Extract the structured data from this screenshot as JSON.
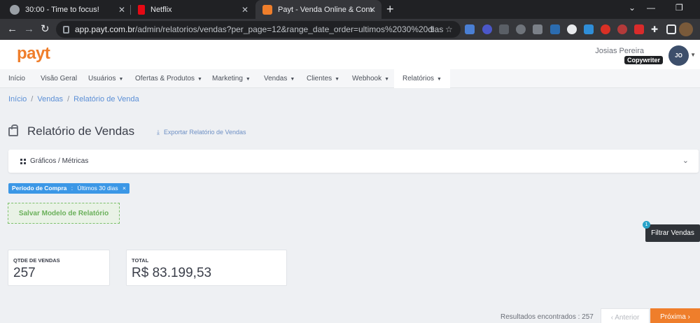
{
  "browser": {
    "tabs": [
      {
        "title": "30:00 - Time to focus!",
        "favicon_color": "#9aa0a6"
      },
      {
        "title": "Netflix",
        "favicon_color": "#e50914"
      },
      {
        "title": "Payt - Venda Online & Conversão",
        "favicon_color": "#ef7e2b"
      }
    ],
    "new_tab": "+",
    "url_host": "app.payt.com.br",
    "url_path": "/admin/relatorios/vendas?per_page=12&range_date_order=ultimos%2030%20dias"
  },
  "header": {
    "logo": "payt",
    "user_name": "Josias Pereira",
    "user_role": "Copywriter",
    "user_initials": "JO"
  },
  "nav": {
    "items": [
      {
        "label": "Início",
        "dropdown": false
      },
      {
        "label": "Visão Geral",
        "dropdown": false
      },
      {
        "label": "Usuários",
        "dropdown": true
      },
      {
        "label": "Ofertas & Produtos",
        "dropdown": true
      },
      {
        "label": "Marketing",
        "dropdown": true
      },
      {
        "label": "Vendas",
        "dropdown": true
      },
      {
        "label": "Clientes",
        "dropdown": true
      },
      {
        "label": "Webhook",
        "dropdown": true
      },
      {
        "label": "Relatórios",
        "dropdown": true
      }
    ]
  },
  "breadcrumb": [
    "Início",
    "Vendas",
    "Relatório de Venda"
  ],
  "page": {
    "title": "Relatório de Vendas",
    "export_label": "Exportar Relatório de Vendas"
  },
  "panel": {
    "label": "Gráficos / Métricas"
  },
  "filter_tag": {
    "name": "Período de Compra",
    "separator": ":",
    "value": "Últimos 30 dias",
    "remove": "×"
  },
  "save_button": "Salvar Modelo de Relatório",
  "filter_button": {
    "label": "Filtrar Vendas",
    "badge": "1"
  },
  "stats": [
    {
      "label": "QTDE DE VENDAS",
      "value": "257"
    },
    {
      "label": "TOTAL",
      "value": "R$ 83.199,53"
    }
  ],
  "pagination": {
    "results_label": "Resultados encontrados : 257",
    "prev": "Anterior",
    "next": "Próxima"
  }
}
